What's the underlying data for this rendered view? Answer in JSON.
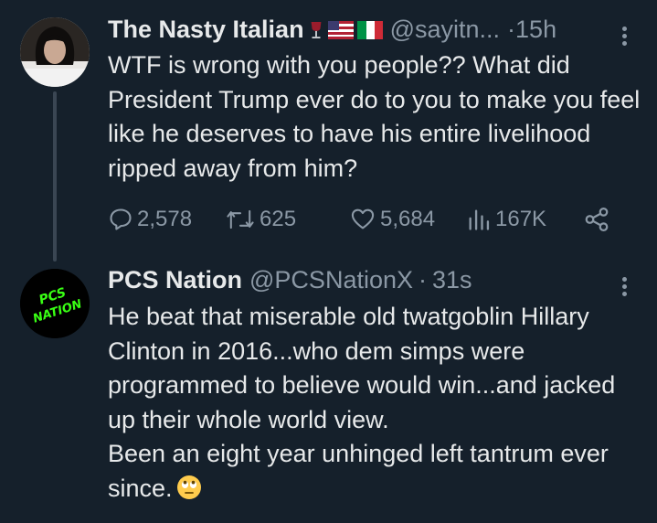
{
  "tweets": [
    {
      "author_name": "The Nasty Italian",
      "handle": "@sayitn...",
      "separator": "·",
      "time": "15h",
      "text": "WTF is wrong with you people?? What did President Trump ever do to you to make you feel like he deserves to have his entire livelihood ripped away from him?",
      "replies": "2,578",
      "retweets": "625",
      "likes": "5,684",
      "views": "167K"
    },
    {
      "author_name": "PCS Nation",
      "handle": "@PCSNationX",
      "separator": "·",
      "time": "31s",
      "text_line1": "He beat that miserable old twatgoblin Hillary Clinton in 2016...who dem simps were programmed to believe would win...and jacked up their whole world view.",
      "text_line2": "Been an eight year unhinged left tantrum ever since.",
      "avatar_text": "PCS NATION"
    }
  ],
  "colors": {
    "background": "#15202b",
    "text": "#e7e9ea",
    "muted": "#8b98a5",
    "avatar_accent": "#39ff14"
  },
  "icons": [
    "wine-glass-icon",
    "us-flag-icon",
    "italy-flag-icon",
    "reply-icon",
    "retweet-icon",
    "like-icon",
    "views-icon",
    "share-icon",
    "more-icon",
    "eye-roll-emoji-icon"
  ]
}
